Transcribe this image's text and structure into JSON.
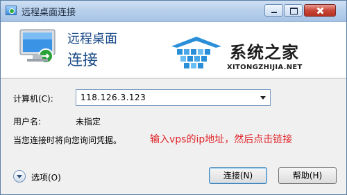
{
  "window": {
    "title": "远程桌面连接"
  },
  "banner": {
    "line1": "远程桌面",
    "line2": "连接",
    "watermark_name": "系统之家",
    "watermark_url": "XITONGZHIJIA.NET"
  },
  "form": {
    "computer_label": "计算机(C):",
    "computer_value": "118.126.3.123",
    "user_label": "用户名:",
    "user_value": "未指定",
    "credentials_note": "当您连接时将向您询问凭据。",
    "annotation": "输入vps的ip地址，然后点击链接"
  },
  "footer": {
    "options_label": "选项(O)",
    "connect_label": "连接(N)",
    "help_label": "帮助(H)"
  },
  "colors": {
    "title_text": "#1f4e8a",
    "annotation": "#e0242a",
    "logo_blue": "#2a8fd8"
  },
  "icons": [
    "remote-desktop-app-icon",
    "minimize-icon",
    "maximize-icon",
    "close-icon",
    "monitor-icon",
    "chevron-down-icon"
  ]
}
